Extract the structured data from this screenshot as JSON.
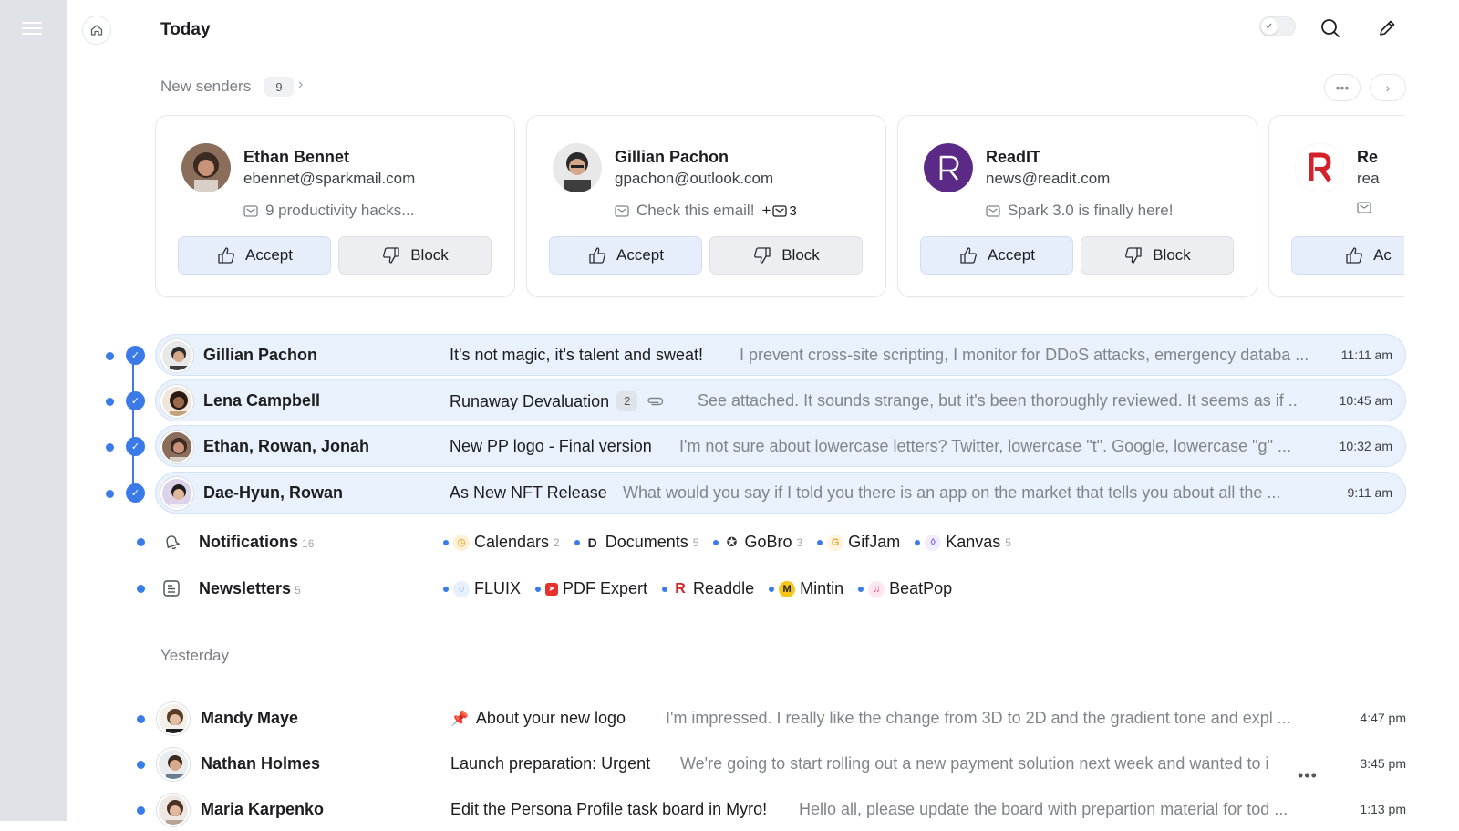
{
  "header": {
    "title": "Today"
  },
  "new_senders": {
    "label": "New senders",
    "count": "9",
    "cards": [
      {
        "name": "Ethan Bennet",
        "email": "ebennet@sparkmail.com",
        "snippet": "9 productivity hacks...",
        "extra": "",
        "accept": "Accept",
        "block": "Block"
      },
      {
        "name": "Gillian Pachon",
        "email": "gpachon@outlook.com",
        "snippet": "Check this email!",
        "extra": "+",
        "extra_count": "3",
        "accept": "Accept",
        "block": "Block"
      },
      {
        "name": "ReadIT",
        "email": "news@readit.com",
        "snippet": "Spark 3.0 is finally here!",
        "extra": "",
        "accept": "Accept",
        "block": "Block"
      },
      {
        "name": "Re",
        "email": "rea",
        "snippet": "",
        "accept": "Ac"
      }
    ]
  },
  "today_threads": [
    {
      "sender": "Gillian Pachon",
      "subject": "It's not magic, it's talent and sweat!",
      "preview": "I prevent cross-site scripting, I monitor for DDoS attacks, emergency databa ...",
      "time": "11:11 am"
    },
    {
      "sender": "Lena Campbell",
      "subject": "Runaway Devaluation",
      "badge": "2",
      "preview": "See attached. It sounds strange, but it's been thoroughly reviewed. It seems as if ..",
      "time": "10:45 am"
    },
    {
      "sender": "Ethan, Rowan, Jonah",
      "subject": "New PP logo - Final version",
      "preview": "I'm not sure about lowercase letters? Twitter, lowercase \"t\". Google, lowercase \"g\" ...",
      "time": "10:32 am"
    },
    {
      "sender": "Dae-Hyun, Rowan",
      "subject": "As New NFT Release",
      "preview": "What would you say if I told you there is an app on the market that tells you about all the ...",
      "time": "9:11 am"
    }
  ],
  "groups": [
    {
      "name": "Notifications",
      "count": "16",
      "chips": [
        {
          "label": "Calendars",
          "count": "2"
        },
        {
          "label": "Documents",
          "count": "5"
        },
        {
          "label": "GoBro",
          "count": "3"
        },
        {
          "label": "GifJam",
          "count": ""
        },
        {
          "label": "Kanvas",
          "count": "5"
        }
      ]
    },
    {
      "name": "Newsletters",
      "count": "5",
      "chips": [
        {
          "label": "FLUIX",
          "count": ""
        },
        {
          "label": "PDF Expert",
          "count": ""
        },
        {
          "label": "Readdle",
          "count": ""
        },
        {
          "label": "Mintin",
          "count": ""
        },
        {
          "label": "BeatPop",
          "count": ""
        }
      ]
    }
  ],
  "yesterday": {
    "label": "Yesterday",
    "threads": [
      {
        "sender": "Mandy Maye",
        "subject": "About your new logo",
        "preview": "I'm impressed. I really like the change from 3D to 2D and the gradient tone and expl ...",
        "time": "4:47 pm"
      },
      {
        "sender": "Nathan Holmes",
        "subject": "Launch preparation: Urgent",
        "preview": "We're going to start rolling out a new payment solution next week and wanted to i",
        "time": "3:45 pm"
      },
      {
        "sender": "Maria Karpenko",
        "subject": "Edit the Persona Profile task board in Myro!",
        "preview": "Hello all, please update the board with prepartion material for tod ...",
        "time": "1:13 pm"
      }
    ]
  },
  "colors": {
    "accent": "#3b7be8",
    "selected_row": "#e9f1fc",
    "sidebar": "#dfe2e6"
  }
}
